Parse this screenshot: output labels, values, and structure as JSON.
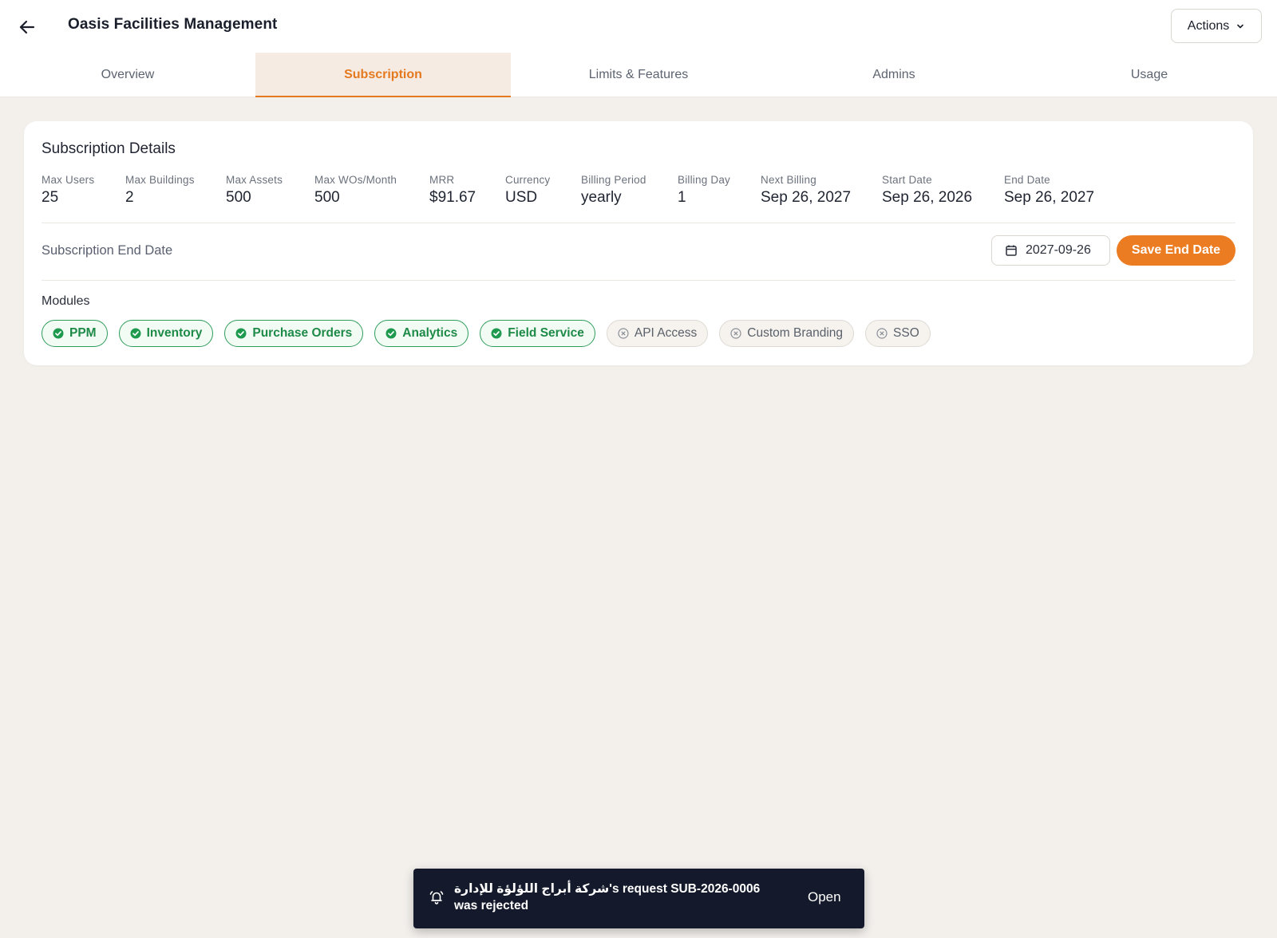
{
  "header": {
    "title": "Oasis Facilities Management",
    "actions_label": "Actions",
    "back_icon": "arrow-left-icon"
  },
  "tabs": [
    {
      "label": "Overview",
      "active": false
    },
    {
      "label": "Subscription",
      "active": true
    },
    {
      "label": "Limits & Features",
      "active": false
    },
    {
      "label": "Admins",
      "active": false
    },
    {
      "label": "Usage",
      "active": false
    }
  ],
  "details": {
    "title": "Subscription Details",
    "stats": [
      {
        "label": "Max Users",
        "value": "25"
      },
      {
        "label": "Max Buildings",
        "value": "2"
      },
      {
        "label": "Max Assets",
        "value": "500"
      },
      {
        "label": "Max WOs/Month",
        "value": "500"
      },
      {
        "label": "MRR",
        "value": "$91.67"
      },
      {
        "label": "Currency",
        "value": "USD"
      },
      {
        "label": "Billing Period",
        "value": "yearly"
      },
      {
        "label": "Billing Day",
        "value": "1"
      },
      {
        "label": "Next Billing",
        "value": "Sep 26, 2027"
      },
      {
        "label": "Start Date",
        "value": "Sep 26, 2026"
      },
      {
        "label": "End Date",
        "value": "Sep 26, 2027"
      }
    ],
    "end_date_label": "Subscription End Date",
    "end_date_value": "2027-09-26",
    "save_label": "Save End Date",
    "modules_label": "Modules",
    "modules": [
      {
        "label": "PPM",
        "enabled": true
      },
      {
        "label": "Inventory",
        "enabled": true
      },
      {
        "label": "Purchase Orders",
        "enabled": true
      },
      {
        "label": "Analytics",
        "enabled": true
      },
      {
        "label": "Field Service",
        "enabled": true
      },
      {
        "label": "API Access",
        "enabled": false
      },
      {
        "label": "Custom Branding",
        "enabled": false
      },
      {
        "label": "SSO",
        "enabled": false
      }
    ]
  },
  "toast": {
    "message": "شركة أبراج اللؤلؤة للإدارة's request SUB-2026-0006 was rejected",
    "action_label": "Open",
    "icon": "bell-ring-icon"
  },
  "colors": {
    "accent": "#ec7c22",
    "success": "#2e9d5a",
    "toast_bg": "#141a2b",
    "page_bg": "#f3f0ec"
  }
}
